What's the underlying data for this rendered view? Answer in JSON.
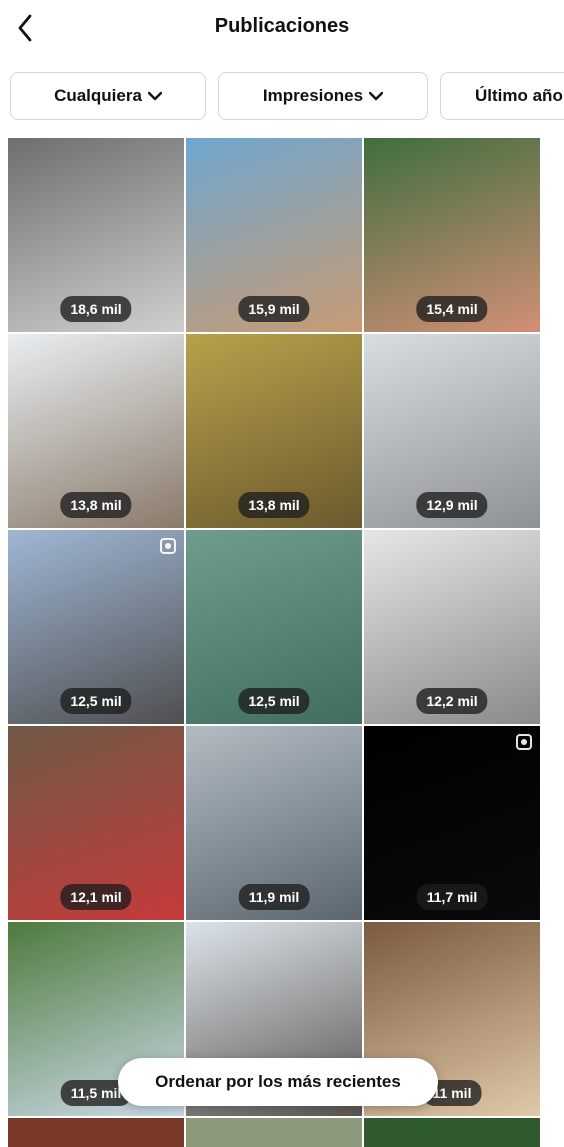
{
  "header": {
    "title": "Publicaciones",
    "back_icon": "chevron-left-icon"
  },
  "filters": [
    {
      "label": "Cualquiera",
      "icon": "chevron-down-icon"
    },
    {
      "label": "Impresiones",
      "icon": "chevron-down-icon"
    },
    {
      "label": "Último año",
      "icon": "chevron-down-icon"
    }
  ],
  "posts": [
    {
      "impressions": "18,6 mil",
      "colors": [
        "#6e6e6e",
        "#cfcfcf"
      ],
      "multi": false
    },
    {
      "impressions": "15,9 mil",
      "colors": [
        "#6fa6cf",
        "#c79b73"
      ],
      "multi": false
    },
    {
      "impressions": "15,4 mil",
      "colors": [
        "#3f6e3e",
        "#d28f76"
      ],
      "multi": false
    },
    {
      "impressions": "13,8 mil",
      "colors": [
        "#e9eef1",
        "#8a7a6a"
      ],
      "multi": false
    },
    {
      "impressions": "13,8 mil",
      "colors": [
        "#b8a14a",
        "#6b5a2e"
      ],
      "multi": false
    },
    {
      "impressions": "12,9 mil",
      "colors": [
        "#d9dde2",
        "#8e9196"
      ],
      "multi": false
    },
    {
      "impressions": "12,5 mil",
      "colors": [
        "#9fb7d4",
        "#4f4f50"
      ],
      "multi": true
    },
    {
      "impressions": "12,5 mil",
      "colors": [
        "#6f9c8d",
        "#3f6e60"
      ],
      "multi": false
    },
    {
      "impressions": "12,2 mil",
      "colors": [
        "#e6e6e6",
        "#8a8a8a"
      ],
      "multi": false
    },
    {
      "impressions": "12,1 mil",
      "colors": [
        "#6f5a46",
        "#c63a3a"
      ],
      "multi": false
    },
    {
      "impressions": "11,9 mil",
      "colors": [
        "#b3bcc3",
        "#5b6670"
      ],
      "multi": false
    },
    {
      "impressions": "11,7 mil",
      "colors": [
        "#000000",
        "#0a0a0a"
      ],
      "multi": true
    },
    {
      "impressions": "11,5 mil",
      "colors": [
        "#4f7a3e",
        "#cbd9e6"
      ],
      "multi": false
    },
    {
      "impressions": "",
      "colors": [
        "#dbe3ea",
        "#5a5550"
      ],
      "multi": false
    },
    {
      "impressions": "11 mil",
      "colors": [
        "#7a5a3e",
        "#e0c9a8"
      ],
      "multi": false
    }
  ],
  "partial_row_colors": [
    "#7a3a2a",
    "#8a9a7a",
    "#2f5a2e"
  ],
  "toast": {
    "label": "Ordenar por los más recientes"
  }
}
